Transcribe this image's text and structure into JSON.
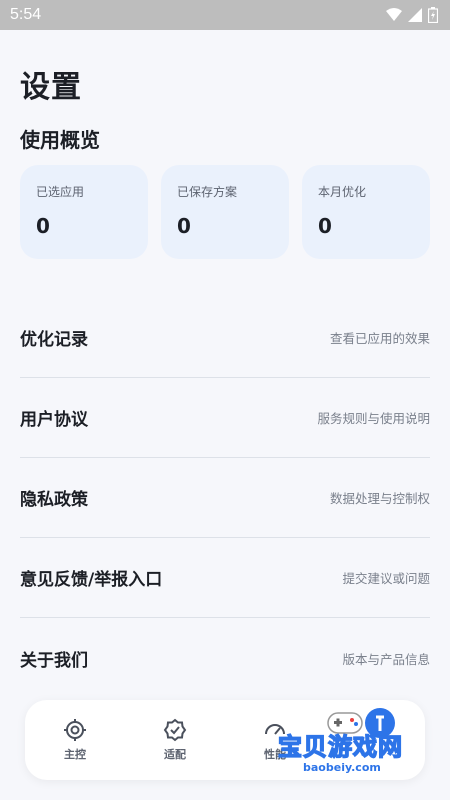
{
  "status_bar": {
    "time": "5:54"
  },
  "page": {
    "title": "设置"
  },
  "overview": {
    "title": "使用概览",
    "stats": [
      {
        "label": "已选应用",
        "value": "0"
      },
      {
        "label": "已保存方案",
        "value": "0"
      },
      {
        "label": "本月优化",
        "value": "0"
      }
    ]
  },
  "menu": [
    {
      "title": "优化记录",
      "desc": "查看已应用的效果"
    },
    {
      "title": "用户协议",
      "desc": "服务规则与使用说明"
    },
    {
      "title": "隐私政策",
      "desc": "数据处理与控制权"
    },
    {
      "title": "意见反馈/举报入口",
      "desc": "提交建议或问题"
    },
    {
      "title": "关于我们",
      "desc": "版本与产品信息"
    }
  ],
  "bottom_nav": [
    {
      "label": "主控",
      "icon": "target-icon"
    },
    {
      "label": "适配",
      "icon": "badge-check-icon"
    },
    {
      "label": "性能",
      "icon": "speedometer-icon"
    }
  ],
  "watermark": {
    "text": "宝贝游戏网",
    "url": "baobeiy.com"
  },
  "colors": {
    "background": "#f6f7fb",
    "card": "#eaf1fc",
    "accent": "#2d74e8",
    "statusbar": "#bdbdbd"
  }
}
